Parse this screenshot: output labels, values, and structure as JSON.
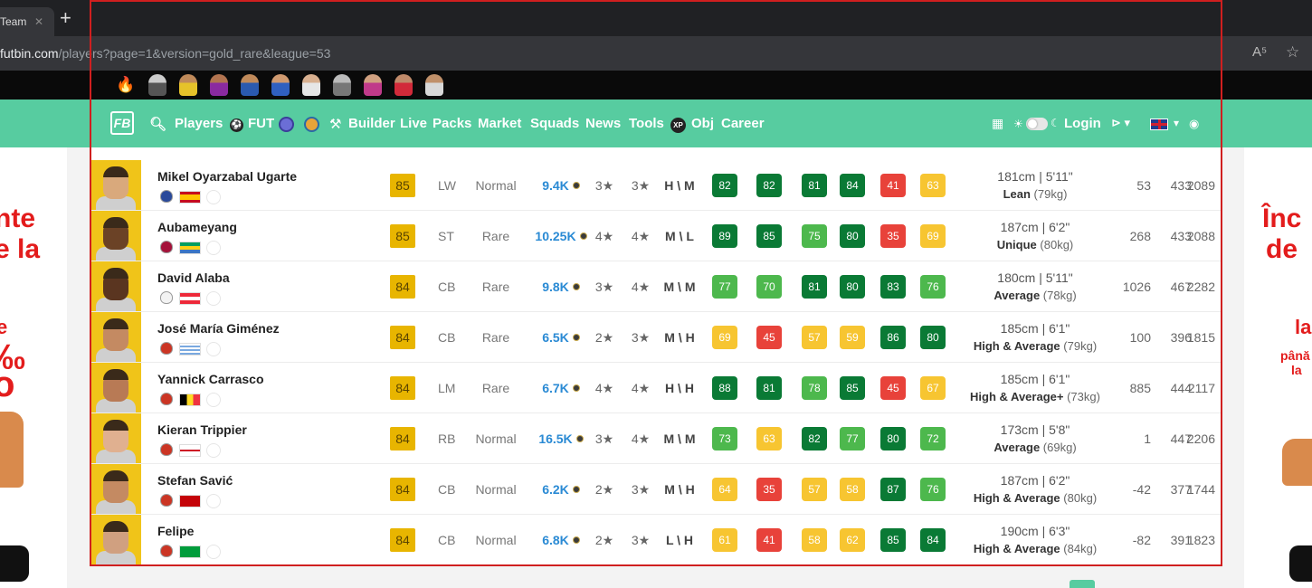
{
  "browser": {
    "tab_title": "Team",
    "url_host": "futbin.com",
    "url_path": "/players?page=1&version=gold_rare&league=53",
    "read_aloud": "A⁵"
  },
  "nav": {
    "items": [
      "Players",
      "FUT",
      "Builder",
      "Live",
      "Packs",
      "Market",
      "Squads",
      "News",
      "Tools",
      "Obj",
      "Career"
    ],
    "login": "Login",
    "xp_label": "XP"
  },
  "promo": {
    "left_lines": [
      "nte",
      "e la",
      "e",
      "‰",
      "o"
    ],
    "right_lines": [
      "Înc",
      "de",
      "la",
      "până",
      "la"
    ]
  },
  "players": [
    {
      "name": "Mikel Oyarzabal Ugarte",
      "rating": "85",
      "pos": "LW",
      "version": "Normal",
      "price": "9.4K",
      "sm": "3★",
      "wf": "3★",
      "wr": "H \\ M",
      "stats": [
        "82",
        "82",
        "81",
        "84",
        "41",
        "63"
      ],
      "height": "181cm | 5'11\"",
      "body": "Lean",
      "weight": "(79kg)",
      "n1": "53",
      "n2": "433",
      "n3": "2089"
    },
    {
      "name": "Aubameyang",
      "rating": "85",
      "pos": "ST",
      "version": "Rare",
      "price": "10.25K",
      "sm": "4★",
      "wf": "4★",
      "wr": "M \\ L",
      "stats": [
        "89",
        "85",
        "75",
        "80",
        "35",
        "69"
      ],
      "height": "187cm | 6'2\"",
      "body": "Unique",
      "weight": "(80kg)",
      "n1": "268",
      "n2": "433",
      "n3": "2088"
    },
    {
      "name": "David Alaba",
      "rating": "84",
      "pos": "CB",
      "version": "Rare",
      "price": "9.8K",
      "sm": "3★",
      "wf": "4★",
      "wr": "M \\ M",
      "stats": [
        "77",
        "70",
        "81",
        "80",
        "83",
        "76"
      ],
      "height": "180cm | 5'11\"",
      "body": "Average",
      "weight": "(78kg)",
      "n1": "1026",
      "n2": "467",
      "n3": "2282"
    },
    {
      "name": "José María Giménez",
      "rating": "84",
      "pos": "CB",
      "version": "Rare",
      "price": "6.5K",
      "sm": "2★",
      "wf": "3★",
      "wr": "M \\ H",
      "stats": [
        "69",
        "45",
        "57",
        "59",
        "86",
        "80"
      ],
      "height": "185cm | 6'1\"",
      "body": "High & Average",
      "weight": "(79kg)",
      "n1": "100",
      "n2": "396",
      "n3": "1815"
    },
    {
      "name": "Yannick Carrasco",
      "rating": "84",
      "pos": "LM",
      "version": "Rare",
      "price": "6.7K",
      "sm": "4★",
      "wf": "4★",
      "wr": "H \\ H",
      "stats": [
        "88",
        "81",
        "78",
        "85",
        "45",
        "67"
      ],
      "height": "185cm | 6'1\"",
      "body": "High & Average+",
      "weight": "(73kg)",
      "n1": "885",
      "n2": "444",
      "n3": "2117"
    },
    {
      "name": "Kieran Trippier",
      "rating": "84",
      "pos": "RB",
      "version": "Normal",
      "price": "16.5K",
      "sm": "3★",
      "wf": "4★",
      "wr": "M \\ M",
      "stats": [
        "73",
        "63",
        "82",
        "77",
        "80",
        "72"
      ],
      "height": "173cm | 5'8\"",
      "body": "Average",
      "weight": "(69kg)",
      "n1": "1",
      "n2": "447",
      "n3": "2206"
    },
    {
      "name": "Stefan Savić",
      "rating": "84",
      "pos": "CB",
      "version": "Normal",
      "price": "6.2K",
      "sm": "2★",
      "wf": "3★",
      "wr": "M \\ H",
      "stats": [
        "64",
        "35",
        "57",
        "58",
        "87",
        "76"
      ],
      "height": "187cm | 6'2\"",
      "body": "High & Average",
      "weight": "(80kg)",
      "n1": "-42",
      "n2": "377",
      "n3": "1744"
    },
    {
      "name": "Felipe",
      "rating": "84",
      "pos": "CB",
      "version": "Normal",
      "price": "6.8K",
      "sm": "2★",
      "wf": "3★",
      "wr": "L \\ H",
      "stats": [
        "61",
        "41",
        "58",
        "62",
        "85",
        "84"
      ],
      "height": "190cm | 6'3\"",
      "body": "High & Average",
      "weight": "(84kg)",
      "n1": "-82",
      "n2": "391",
      "n3": "1823"
    }
  ],
  "colors": {
    "nav": "#57cca0",
    "rating_gold": "#e8b500",
    "stat_dark_green": "#0a7a35",
    "stat_green": "#4db84d",
    "stat_yellow": "#f7c531",
    "stat_red": "#e8423a",
    "price_blue": "#2a8ad4"
  }
}
